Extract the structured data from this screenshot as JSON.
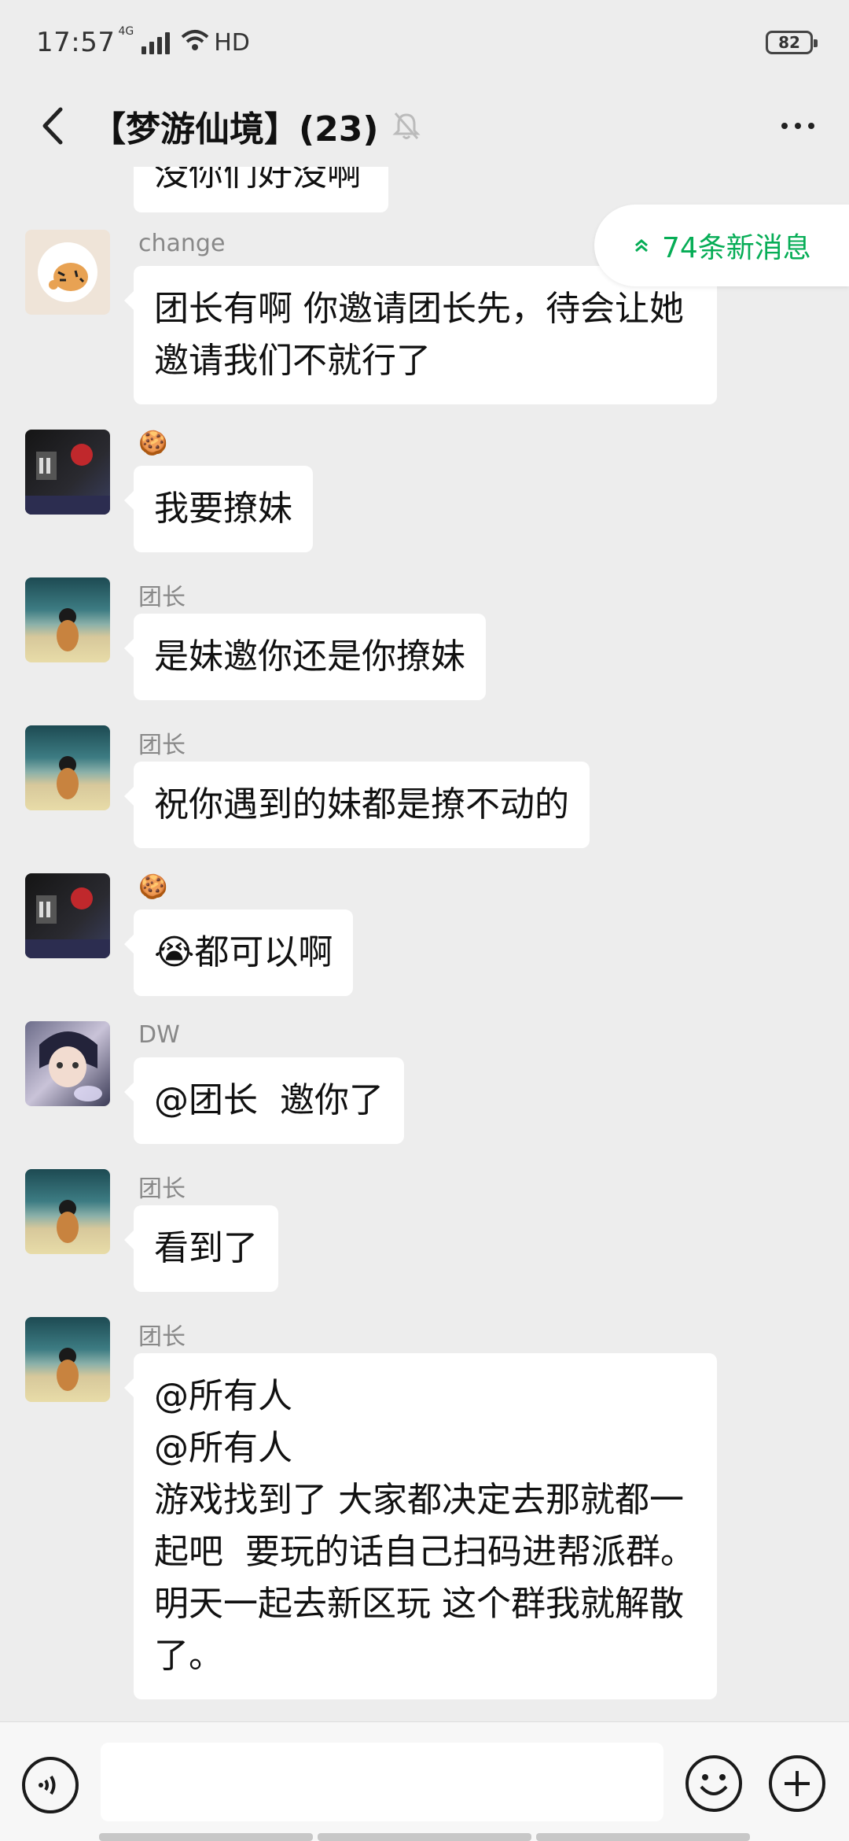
{
  "status": {
    "time": "17:57",
    "network": "4G",
    "hd": "HD",
    "battery": "82"
  },
  "header": {
    "title": "【梦游仙境】(23)"
  },
  "partial_top_text": "没你们好没啊",
  "new_messages": "74条新消息",
  "messages": [
    {
      "sender": "change",
      "avatar": "tiger",
      "lines": [
        "团长有啊 你邀请团长先，待会让她",
        "邀请我们不就行了"
      ]
    },
    {
      "sender": "🍪",
      "avatar": "dark",
      "lines": [
        "我要撩妹"
      ]
    },
    {
      "sender": "团长",
      "avatar": "beach",
      "lines": [
        "是妹邀你还是你撩妹"
      ]
    },
    {
      "sender": "团长",
      "avatar": "beach",
      "lines": [
        "祝你遇到的妹都是撩不动的"
      ]
    },
    {
      "sender": "🍪",
      "avatar": "dark",
      "lines": [
        "😭都可以啊"
      ]
    },
    {
      "sender": "DW",
      "avatar": "anime",
      "lines": [
        "@团长  邀你了"
      ]
    },
    {
      "sender": "团长",
      "avatar": "beach",
      "lines": [
        "看到了"
      ]
    },
    {
      "sender": "团长",
      "avatar": "beach",
      "lines": [
        "@所有人",
        "@所有人",
        "游戏找到了 大家都决定去那就都一",
        "起吧  要玩的话自己扫码进帮派群。",
        "明天一起去新区玩 这个群我就解散",
        "了。"
      ]
    }
  ],
  "colors": {
    "accent": "#06ad56",
    "background": "#ededed",
    "bubble": "#ffffff"
  }
}
